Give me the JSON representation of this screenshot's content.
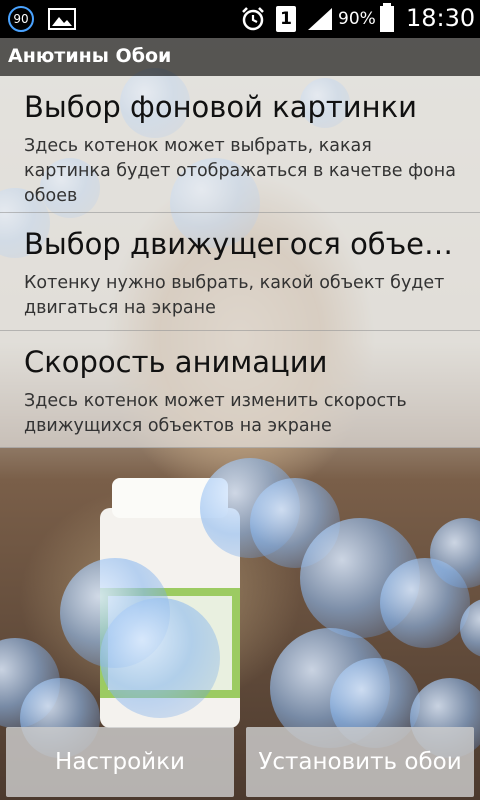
{
  "status_bar": {
    "notification_count": "90",
    "battery_percent": "90%",
    "sim_slot": "1",
    "time": "18:30",
    "icons": [
      "notification-badge",
      "image-icon",
      "alarm-clock-icon",
      "sim-icon",
      "signal-icon",
      "battery-icon"
    ]
  },
  "app_bar": {
    "title": "Анютины Обои"
  },
  "preferences": [
    {
      "title": "Выбор фоновой картинки",
      "summary": "Здесь котенок может выбрать, какая картинка будет отображаться в качетве фона обоев"
    },
    {
      "title": "Выбор движущегося объе…",
      "summary": "Котенку нужно выбрать, какой объект будет двигаться на экране"
    },
    {
      "title": "Скорость анимации",
      "summary": "Здесь котенок может изменить скорость движущихся объектов на экране"
    }
  ],
  "buttons": {
    "settings": "Настройки",
    "set_wallpaper": "Установить обои"
  },
  "colors": {
    "status_bar": "#000000",
    "accent_badge": "#4aa3ff",
    "bubble": "#8cb9f0"
  }
}
